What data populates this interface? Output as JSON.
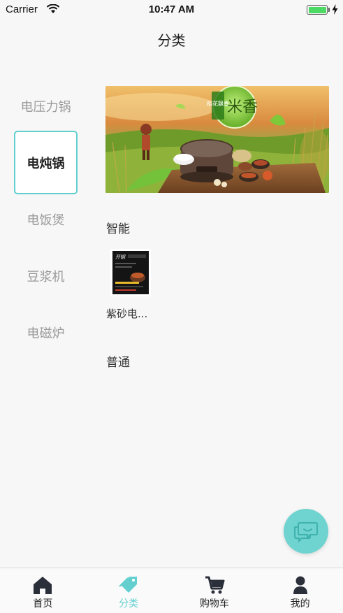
{
  "status_bar": {
    "carrier": "Carrier",
    "time": "10:47 AM"
  },
  "nav": {
    "title": "分类"
  },
  "sidebar": {
    "items": [
      {
        "label": "电压力锅",
        "active": false
      },
      {
        "label": "电炖锅",
        "active": true
      },
      {
        "label": "电饭煲",
        "active": false
      },
      {
        "label": "豆浆机",
        "active": false
      },
      {
        "label": "电磁炉",
        "active": false
      }
    ]
  },
  "banner": {
    "headline": "米香",
    "badge": "稻花飘香"
  },
  "sections": [
    {
      "title": "智能",
      "products": [
        {
          "name": "紫砂电...",
          "thumb_title": "开锅"
        }
      ]
    },
    {
      "title": "普通",
      "products": []
    }
  ],
  "tab_bar": {
    "items": [
      {
        "label": "首页",
        "icon": "home-icon",
        "active": false
      },
      {
        "label": "分类",
        "icon": "tag-icon",
        "active": true
      },
      {
        "label": "购物车",
        "icon": "cart-icon",
        "active": false
      },
      {
        "label": "我的",
        "icon": "user-icon",
        "active": false
      }
    ]
  },
  "colors": {
    "accent": "#63cfcf",
    "fab": "#6fd3cf",
    "tab_active": "#63cfcf"
  }
}
